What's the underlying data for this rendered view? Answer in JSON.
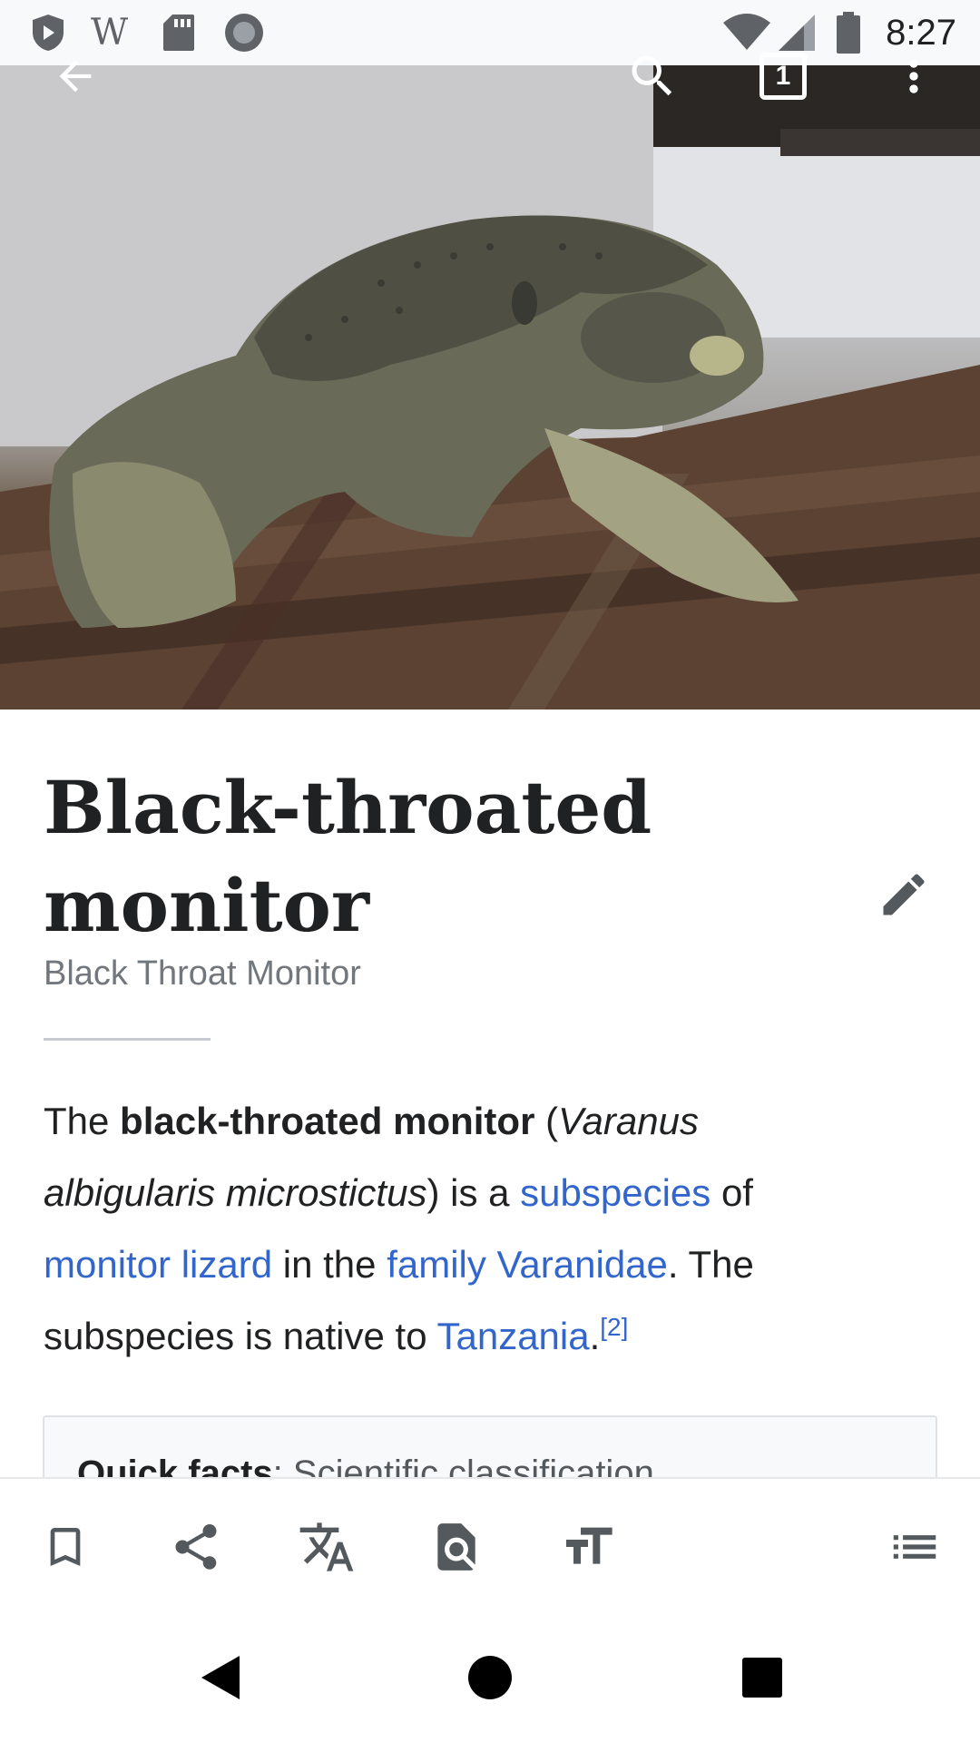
{
  "status_bar": {
    "time": "8:27",
    "left_icons": [
      "play-protect-icon",
      "wikipedia-w-icon",
      "sd-card-icon",
      "circle-record-icon"
    ],
    "right_icons": [
      "wifi-icon",
      "cell-signal-icon",
      "battery-icon"
    ],
    "wikipedia_glyph": "W"
  },
  "toolbar": {
    "tab_count": "1",
    "icons": [
      "back-arrow-icon",
      "search-icon",
      "tabs-icon",
      "overflow-menu-icon"
    ]
  },
  "article": {
    "title_line1": "Black-throated",
    "title_line2": "monitor",
    "description": "Black Throat Monitor",
    "body": {
      "p1": "The ",
      "bold_term": "black-throated monitor",
      "p2": " (",
      "italic_name_1": "Varanus",
      "italic_name_2": "albigularis microstictus",
      "p3": ") is a ",
      "link_subspecies": "subspecies",
      "p4": " of",
      "link_monitor_lizard": "monitor lizard",
      "p5": " in the ",
      "link_family": "family Varanidae",
      "p6": ". The",
      "p7": "subspecies is native to ",
      "link_tanzania": "Tanzania",
      "p8": ".",
      "citation": "[2]"
    },
    "quick_facts": {
      "label": "Quick facts",
      "text": ": Scientific classification"
    }
  },
  "action_bar": {
    "icons": [
      "bookmark-icon",
      "share-icon",
      "translate-icon",
      "find-in-page-icon",
      "text-size-icon",
      "table-of-contents-icon"
    ]
  },
  "nav_bar": {
    "icons": [
      "nav-back-icon",
      "nav-home-icon",
      "nav-recents-icon"
    ]
  },
  "colors": {
    "link": "#3366cc",
    "text": "#202122",
    "secondary_text": "#72777d",
    "status_bar_bg": "#f8f9fa"
  }
}
